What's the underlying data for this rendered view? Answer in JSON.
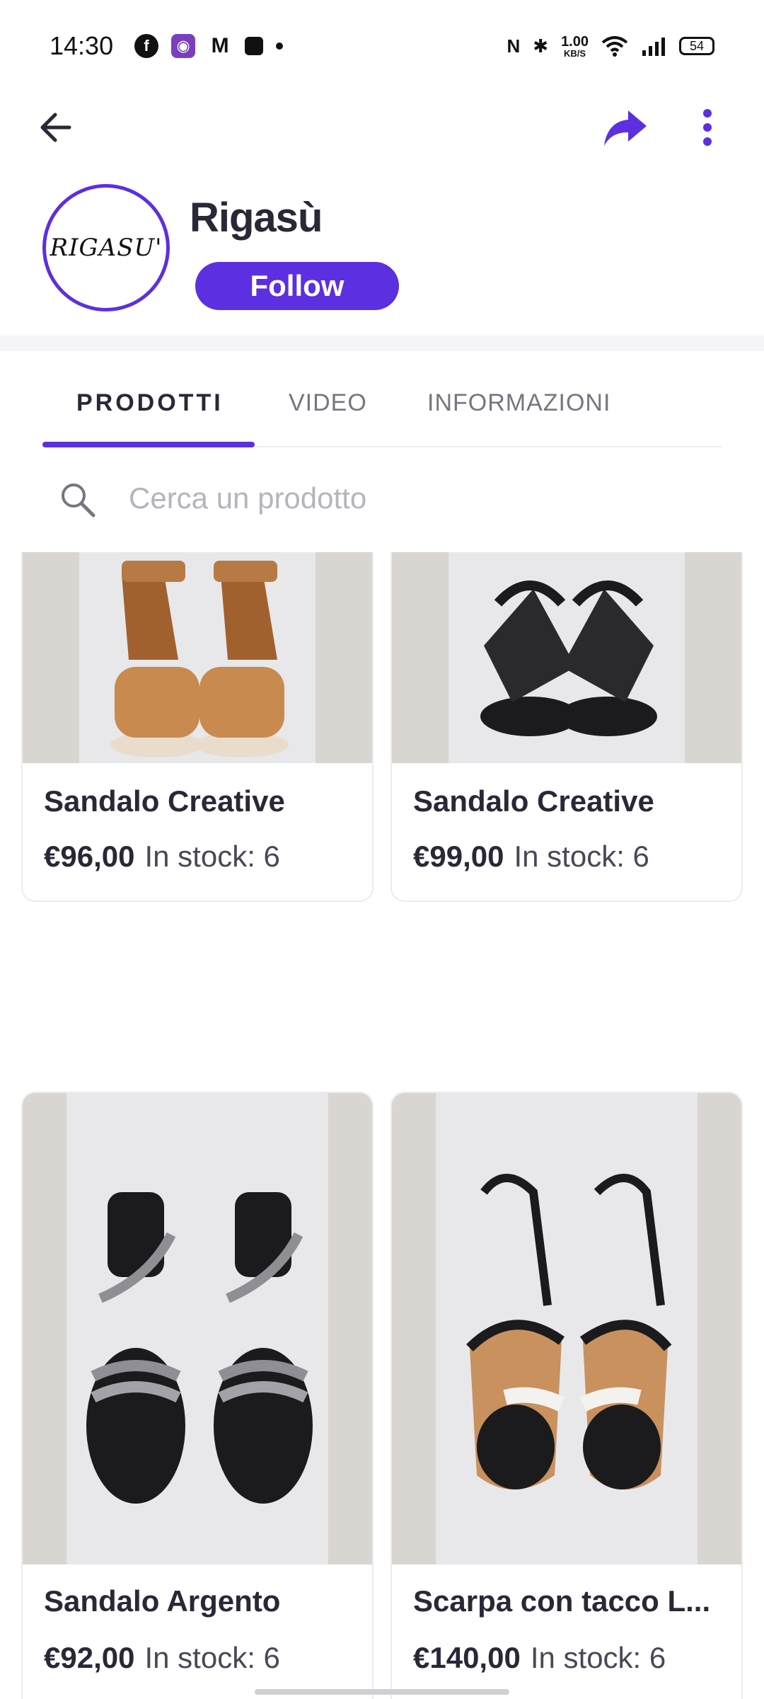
{
  "status_bar": {
    "time": "14:30",
    "speed_value": "1.00",
    "speed_unit": "KB/S",
    "battery": "54",
    "icons": [
      "facebook-icon",
      "camera-app-icon",
      "gmail-icon",
      "lock-icon",
      "nfc-icon",
      "bluetooth-icon",
      "wifi-icon",
      "signal-icon",
      "battery-icon"
    ]
  },
  "nav": {
    "back_icon": "arrow-left-icon",
    "share_icon": "share-icon",
    "more_icon": "more-vertical-icon"
  },
  "shop": {
    "logo_text": "RIGASU'",
    "name": "Rigasù",
    "follow_label": "Follow"
  },
  "tabs": [
    {
      "label": "PRODOTTI",
      "active": true
    },
    {
      "label": "VIDEO",
      "active": false
    },
    {
      "label": "INFORMAZIONI",
      "active": false
    }
  ],
  "search": {
    "placeholder": "Cerca un prodotto",
    "value": ""
  },
  "products": [
    {
      "title": "Sandalo Creative",
      "price": "€96,00",
      "stock": "In stock: 6",
      "image": "tan-braided-sandal"
    },
    {
      "title": "Sandalo Creative",
      "price": "€99,00",
      "stock": "In stock: 6",
      "image": "black-crossed-sandal"
    },
    {
      "title": "Sandalo Argento",
      "price": "€92,00",
      "stock": "In stock: 6",
      "image": "silver-strap-sandal"
    },
    {
      "title": "Scarpa con tacco L...",
      "price": "€140,00",
      "stock": "In stock: 6",
      "image": "black-tan-heeled-sandal"
    }
  ],
  "colors": {
    "accent": "#5c2fe0",
    "text": "#2b2737",
    "muted": "#77757f"
  }
}
